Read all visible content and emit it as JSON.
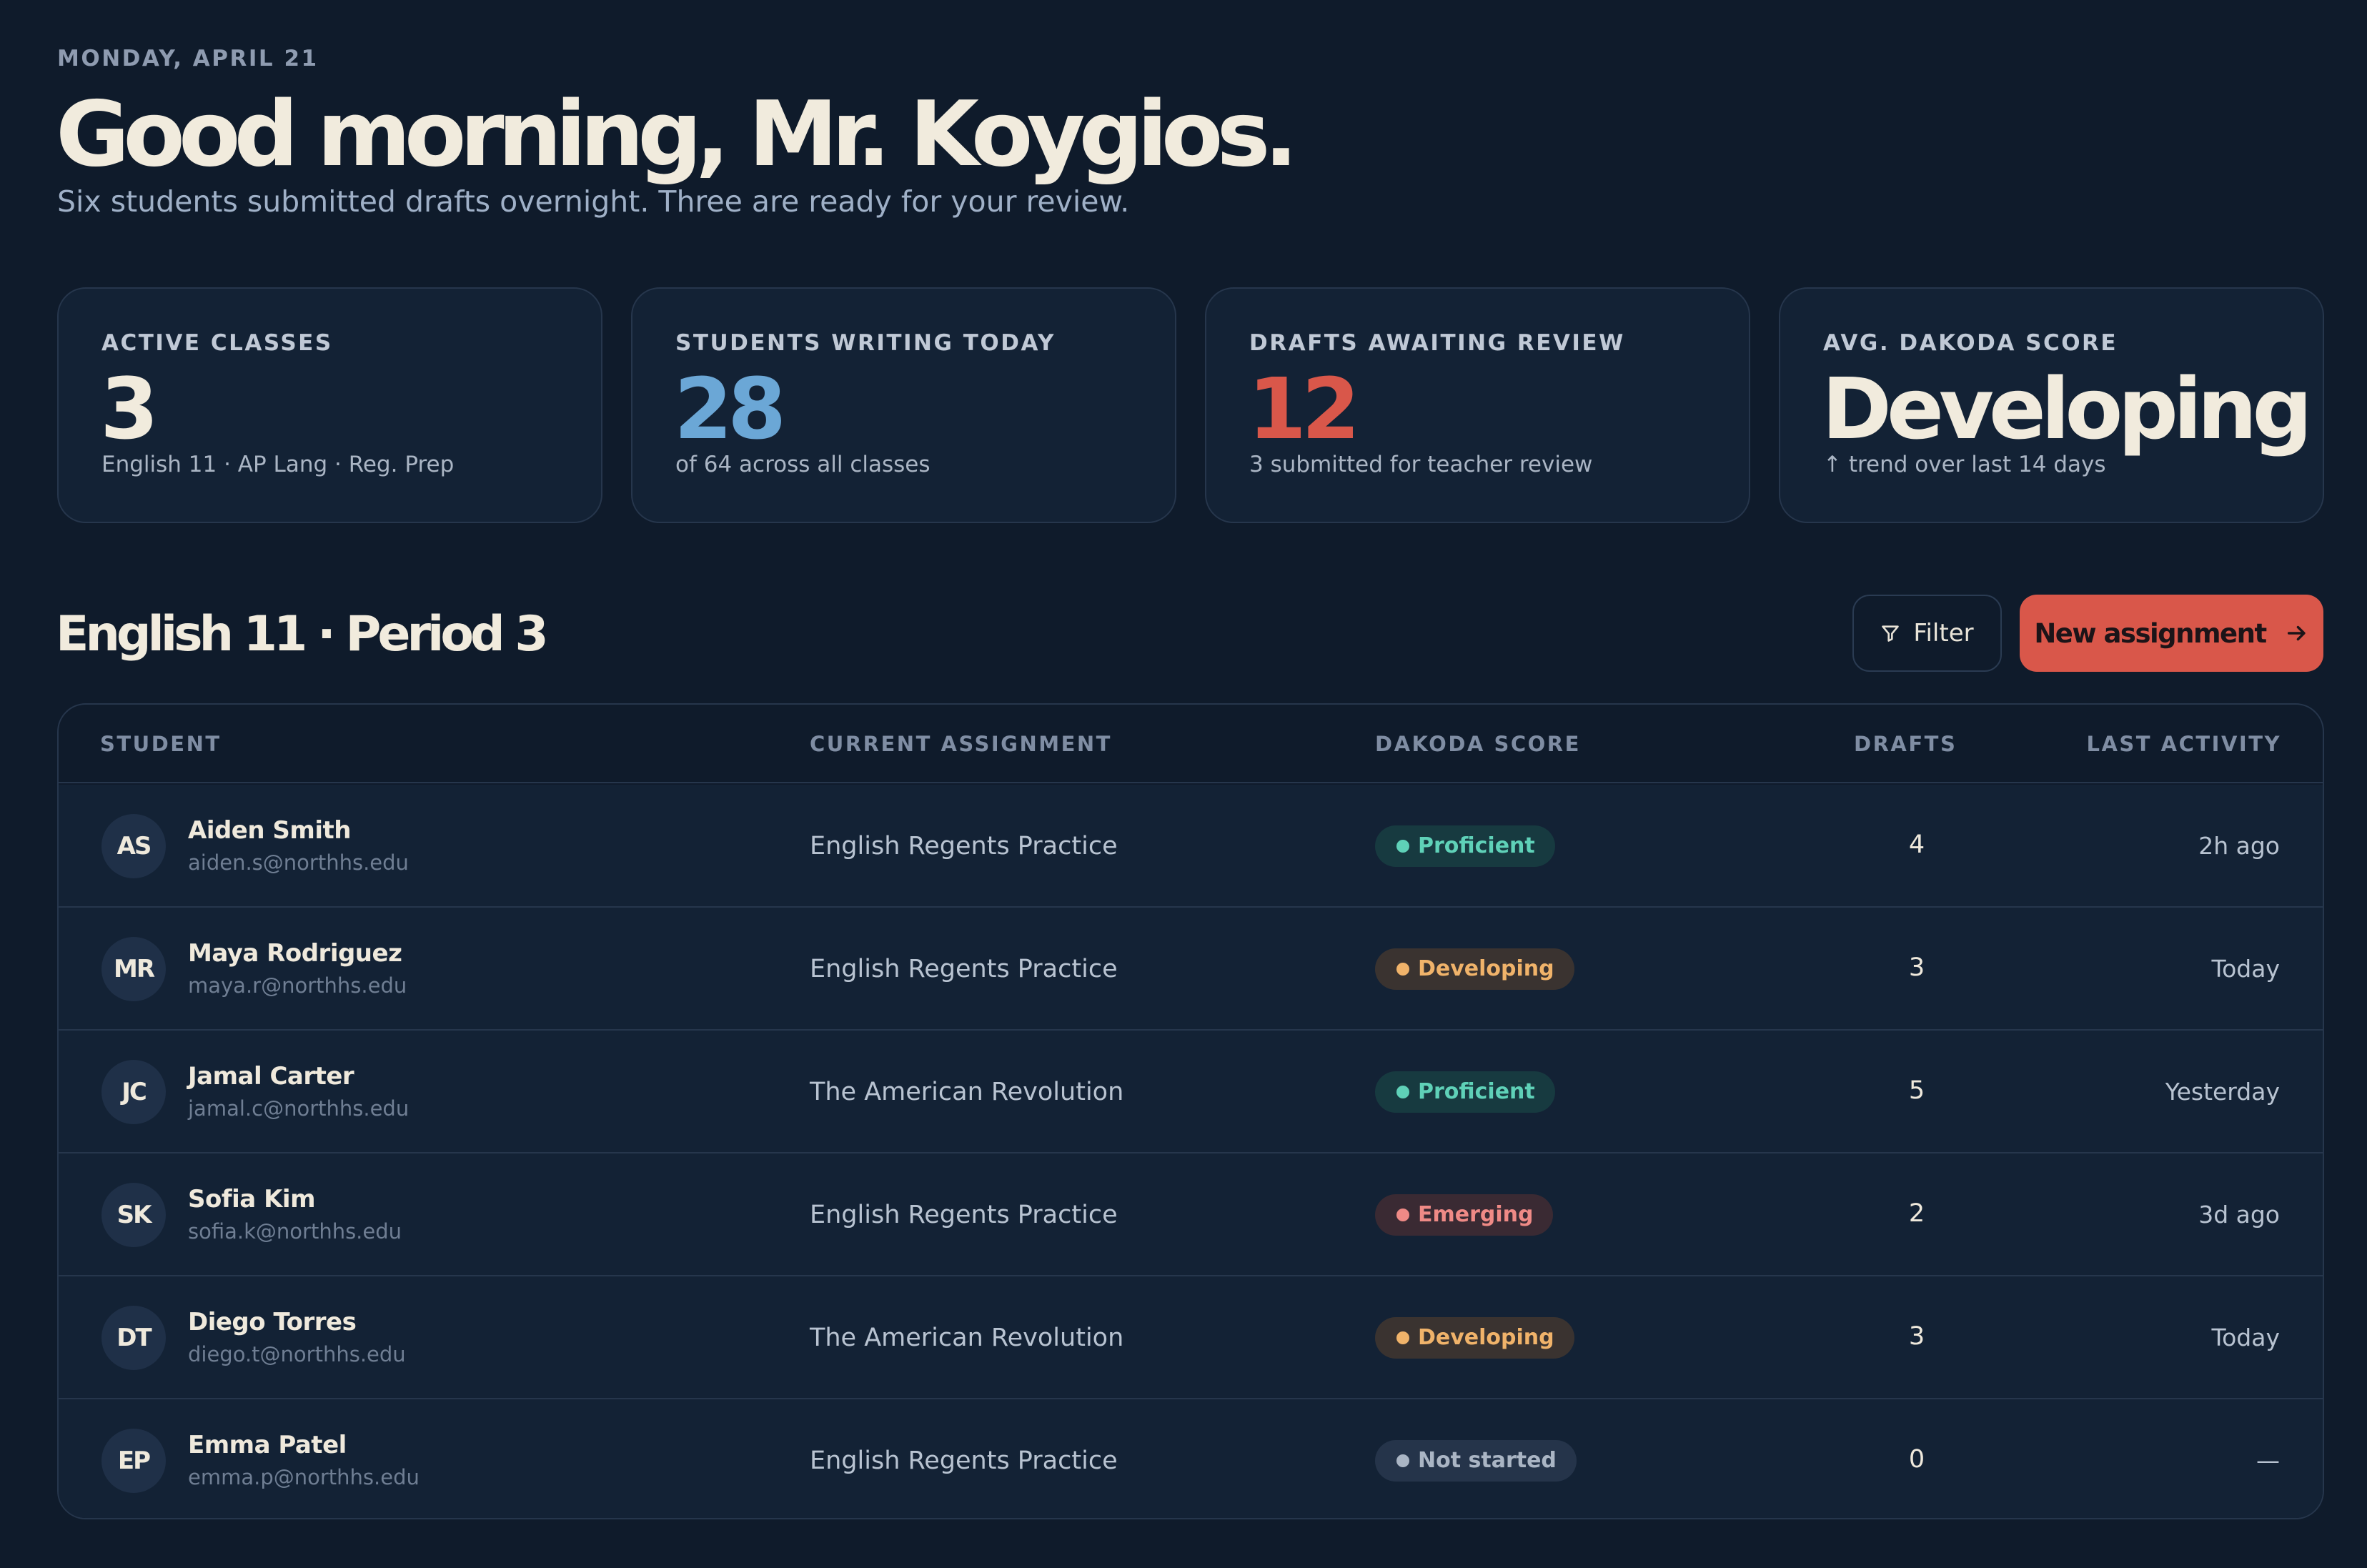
{
  "header": {
    "date": "MONDAY, APRIL 21",
    "greeting": "Good morning, Mr. Koygios.",
    "subtitle": "Six students submitted drafts overnight. Three are ready for your review."
  },
  "stats": [
    {
      "label": "ACTIVE CLASSES",
      "value": "3",
      "caption": "English 11 · AP Lang · Reg. Prep",
      "color": "#f1ebdd"
    },
    {
      "label": "STUDENTS WRITING TODAY",
      "value": "28",
      "caption": "of 64 across all classes",
      "color": "#6ba7d6"
    },
    {
      "label": "DRAFTS AWAITING REVIEW",
      "value": "12",
      "caption": "3 submitted for teacher review",
      "color": "#d9574a"
    },
    {
      "label": "AVG. DAKODA SCORE",
      "value": "Developing",
      "caption": "↑ trend over last 14 days",
      "color": "#f1ebdd"
    }
  ],
  "section": {
    "title": "English 11 · Period 3",
    "filter_label": "Filter",
    "filter_icon": "filter-icon",
    "new_assignment_label": "New assignment",
    "new_assignment_icon": "arrow-right-icon",
    "accent": "#d9574a"
  },
  "table": {
    "columns": [
      "STUDENT",
      "CURRENT ASSIGNMENT",
      "DAKODA SCORE",
      "DRAFTS",
      "LAST ACTIVITY"
    ],
    "rows": [
      {
        "initials": "AS",
        "name": "Aiden Smith",
        "email": "aiden.s@northhs.edu",
        "assignment": "English Regents Practice",
        "score": "Proficient",
        "drafts": "4",
        "activity": "2h ago"
      },
      {
        "initials": "MR",
        "name": "Maya Rodriguez",
        "email": "maya.r@northhs.edu",
        "assignment": "English Regents Practice",
        "score": "Developing",
        "drafts": "3",
        "activity": "Today"
      },
      {
        "initials": "JC",
        "name": "Jamal Carter",
        "email": "jamal.c@northhs.edu",
        "assignment": "The American Revolution",
        "score": "Proficient",
        "drafts": "5",
        "activity": "Yesterday"
      },
      {
        "initials": "SK",
        "name": "Sofia Kim",
        "email": "sofia.k@northhs.edu",
        "assignment": "English Regents Practice",
        "score": "Emerging",
        "drafts": "2",
        "activity": "3d ago"
      },
      {
        "initials": "DT",
        "name": "Diego Torres",
        "email": "diego.t@northhs.edu",
        "assignment": "The American Revolution",
        "score": "Developing",
        "drafts": "3",
        "activity": "Today"
      },
      {
        "initials": "EP",
        "name": "Emma Patel",
        "email": "emma.p@northhs.edu",
        "assignment": "English Regents Practice",
        "score": "Not started",
        "drafts": "0",
        "activity": "—"
      }
    ]
  },
  "score_colors": {
    "Proficient": {
      "text": "#5fd1b8",
      "bg": "#173a40"
    },
    "Developing": {
      "text": "#f0b36a",
      "bg": "#3a3330"
    },
    "Emerging": {
      "text": "#ef8a86",
      "bg": "#3a2a33"
    },
    "Not started": {
      "text": "#aab5c4",
      "bg": "#25344a"
    }
  }
}
